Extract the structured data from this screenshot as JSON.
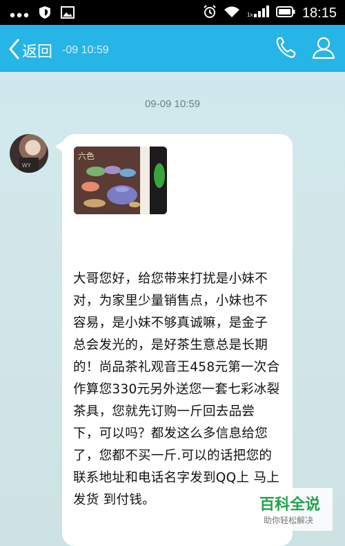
{
  "status_bar": {
    "time": "18:15",
    "icons": [
      "more-dots-icon",
      "shield-icon",
      "image-icon",
      "alarm-icon",
      "wifi-icon",
      "signal-icon",
      "battery-icon"
    ]
  },
  "header": {
    "back_label": "返回",
    "subtitle": "-09 10:59",
    "icons": [
      "phone-icon",
      "person-icon"
    ]
  },
  "chat": {
    "timestamp": "09-09 10:59",
    "message": {
      "text": "大哥您好，给您带来打扰是小妹不对，为家里少量销售点，小妹也不容易，是小妹不够真诚嘛，是金子总会发光的，是好茶生意总是长期的！尚品茶礼观音王458元第一次合作算您330元另外送您一套七彩冰裂茶具，您就先订购一斤回去品尝下，可以吗？都发这么多信息给您了，您都不买一斤.可以的话把您的联系地址和电话名字发到QQ上 马上发货 到付钱。"
    }
  },
  "watermark": {
    "title": "百科全说",
    "subtitle": "助你轻松解决"
  },
  "colors": {
    "header_bg": "#27b4e6",
    "chat_bg": "#d0e8ec",
    "bubble_bg": "#ffffff",
    "watermark_green": "#21a34b"
  }
}
